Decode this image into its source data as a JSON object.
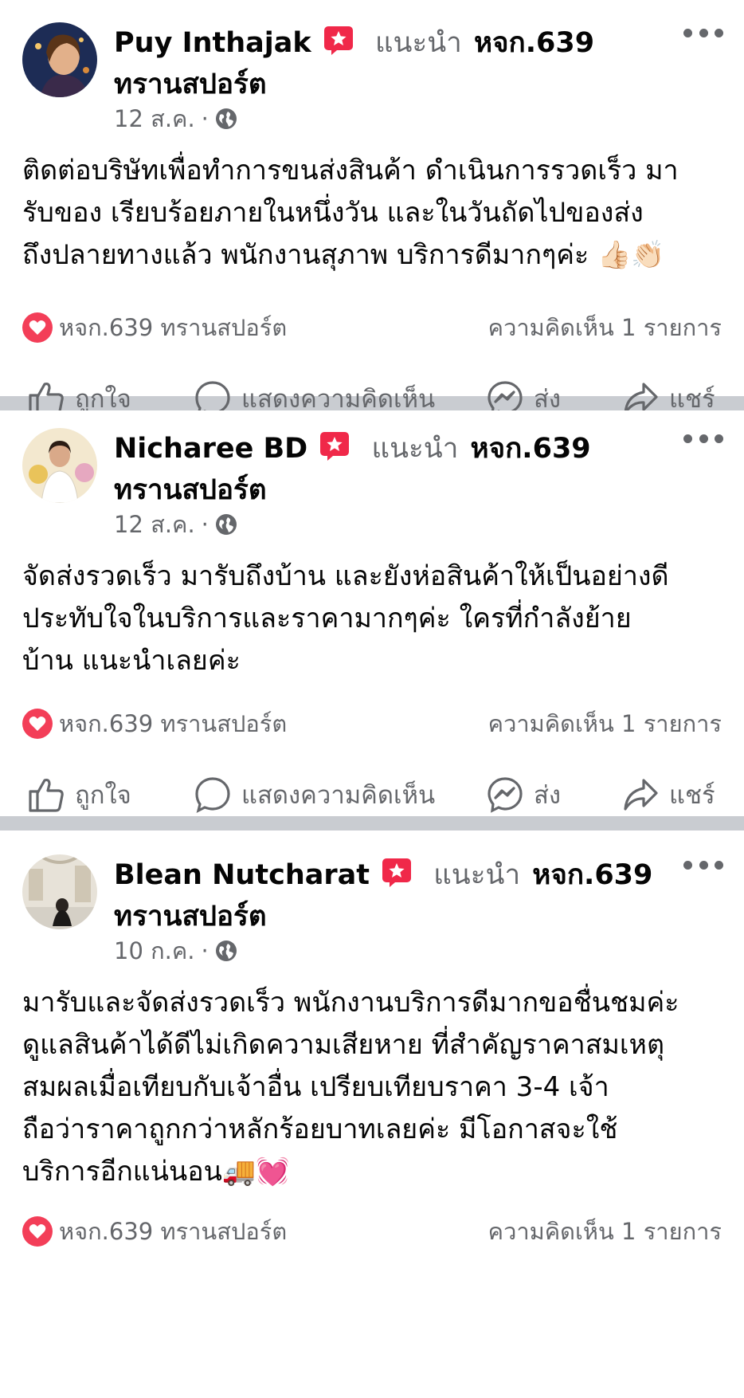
{
  "posts": [
    {
      "author": "Puy Inthajak",
      "recommends_label": "แนะนำ",
      "page_line1": "หจก.639",
      "page_line2": "ทรานสปอร์ต",
      "date": "12 ส.ค.",
      "dot": "·",
      "text": "ติดต่อบริษัทเพื่อทำการขนส่งสินค้า ดำเนินการรวดเร็ว มา\nรับของ เรียบร้อยภายในหนึ่งวัน และในวันถัดไปของส่ง\nถึงปลายทางแล้ว พนักงานสุภาพ บริการดีมากๆค่ะ 👍🏻👏🏻",
      "reaction_by": "หจก.639 ทรานสปอร์ต",
      "comments": "ความคิดเห็น 1 รายการ"
    },
    {
      "author": "Nicharee BD",
      "recommends_label": "แนะนำ",
      "page_line1": "หจก.639",
      "page_line2": "ทรานสปอร์ต",
      "date": "12 ส.ค.",
      "dot": "·",
      "text": "จัดส่งรวดเร็ว มารับถึงบ้าน และยังห่อสินค้าให้เป็นอย่างดี\nประทับใจในบริการและราคามากๆค่ะ ใครที่กำลังย้าย\nบ้าน แนะนำเลยค่ะ",
      "reaction_by": "หจก.639 ทรานสปอร์ต",
      "comments": "ความคิดเห็น 1 รายการ"
    },
    {
      "author": "Blean Nutcharat",
      "recommends_label": "แนะนำ",
      "page_line1": "หจก.639",
      "page_line2": "ทรานสปอร์ต",
      "date": "10 ก.ค.",
      "dot": "·",
      "text": "มารับและจัดส่งรวดเร็ว พนักงานบริการดีมากขอชื่นชมค่ะ\nดูแลสินค้าได้ดีไม่เกิดความเสียหาย ที่สำคัญราคาสมเหตุ\nสมผลเมื่อเทียบกับเจ้าอื่น เปรียบเทียบราคา 3-4 เจ้า\nถือว่าราคาถูกกว่าหลักร้อยบาทเลยค่ะ มีโอกาสจะใช้\nบริการอีกแน่นอน🚚💓",
      "reaction_by": "หจก.639 ทรานสปอร์ต",
      "comments": "ความคิดเห็น 1 รายการ"
    }
  ],
  "actions": {
    "like": "ถูกใจ",
    "comment": "แสดงความคิดเห็น",
    "send": "ส่ง",
    "share": "แชร์"
  },
  "colors": {
    "secondary_text": "#65676b",
    "divider": "#c9ccd1",
    "love_red": "#f33e58",
    "recommend_red": "#f02849"
  },
  "icons": [
    "recommend-star-icon",
    "globe-icon",
    "more-icon",
    "love-reaction-icon",
    "like-icon",
    "comment-icon",
    "messenger-icon",
    "share-icon"
  ]
}
